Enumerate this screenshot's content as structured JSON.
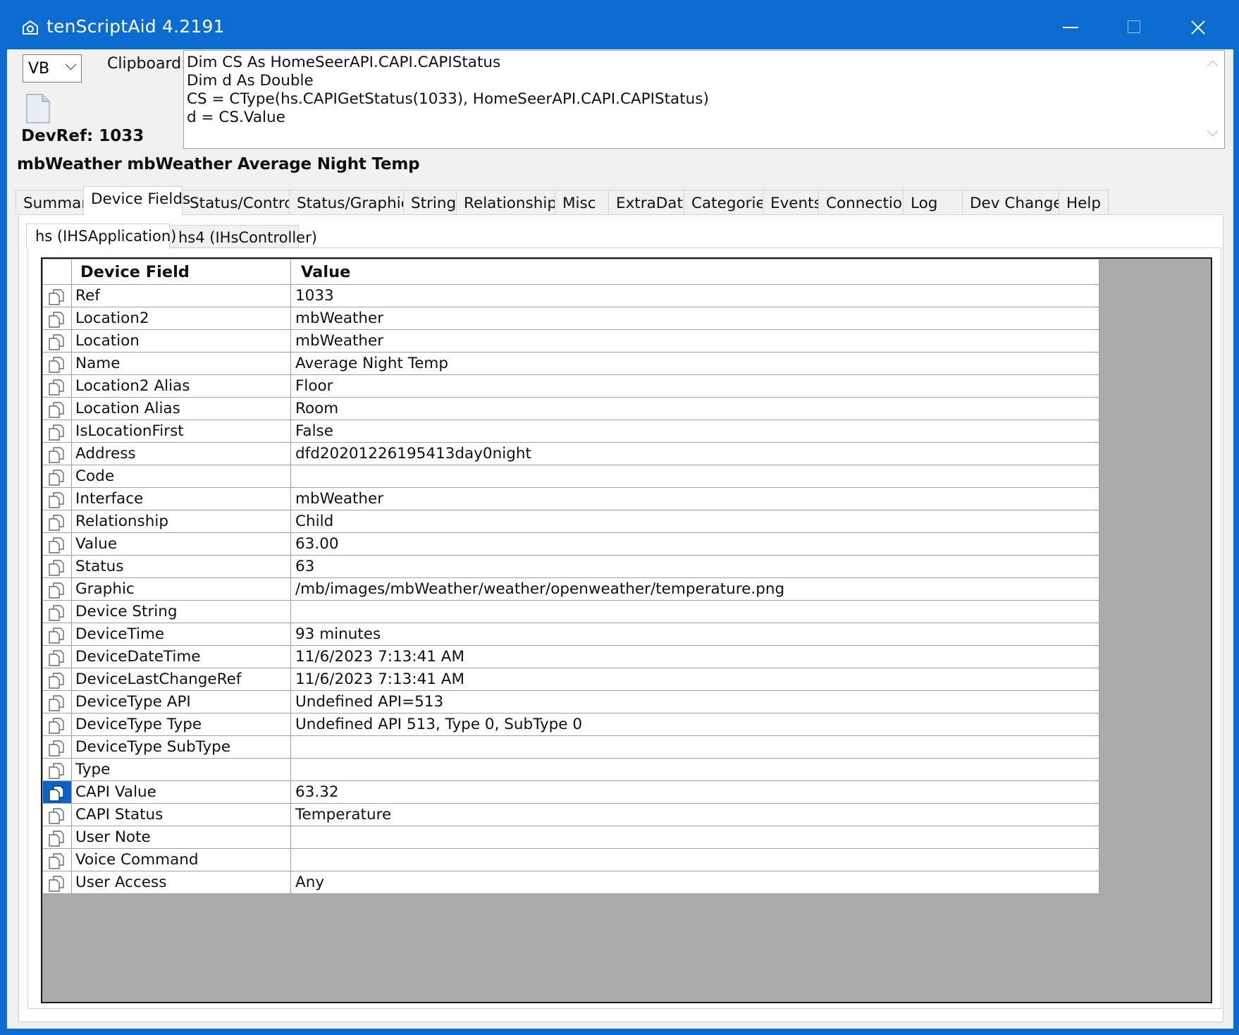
{
  "window": {
    "title": "tenScriptAid 4.2191"
  },
  "toolbar": {
    "language": "VB",
    "clipboard_label": "Clipboard:",
    "clipboard_lines": [
      "Dim CS As HomeSeerAPI.CAPI.CAPIStatus",
      "Dim d As Double",
      "CS = CType(hs.CAPIGetStatus(1033), HomeSeerAPI.CAPI.CAPIStatus)",
      "d = CS.Value"
    ],
    "devref": "DevRef: 1033",
    "device_name": "mbWeather mbWeather Average Night Temp"
  },
  "tabs": [
    "Summary",
    "Device Fields",
    "Status/Controls",
    "Status/Graphics",
    "String",
    "Relationships",
    "Misc",
    "ExtraData",
    "Categories",
    "Events",
    "Connection",
    "Log",
    "Dev Changes",
    "Help"
  ],
  "active_tab": "Device Fields",
  "subtabs": [
    "hs (IHSApplication)",
    "hs4 (IHsController)"
  ],
  "active_subtab": "hs (IHSApplication)",
  "grid": {
    "headers": [
      "Device Field",
      "Value"
    ],
    "rows": [
      {
        "field": "Ref",
        "value": "1033"
      },
      {
        "field": "Location2",
        "value": "mbWeather"
      },
      {
        "field": "Location",
        "value": "mbWeather"
      },
      {
        "field": "Name",
        "value": "Average Night Temp"
      },
      {
        "field": "Location2 Alias",
        "value": "Floor"
      },
      {
        "field": "Location Alias",
        "value": "Room"
      },
      {
        "field": "IsLocationFirst",
        "value": "False"
      },
      {
        "field": "Address",
        "value": "dfd20201226195413day0night"
      },
      {
        "field": "Code",
        "value": ""
      },
      {
        "field": "Interface",
        "value": "mbWeather"
      },
      {
        "field": "Relationship",
        "value": "Child"
      },
      {
        "field": "Value",
        "value": "63.00"
      },
      {
        "field": "Status",
        "value": "63"
      },
      {
        "field": "Graphic",
        "value": "/mb/images/mbWeather/weather/openweather/temperature.png"
      },
      {
        "field": "Device String",
        "value": ""
      },
      {
        "field": "DeviceTime",
        "value": "93 minutes"
      },
      {
        "field": "DeviceDateTime",
        "value": "11/6/2023 7:13:41 AM"
      },
      {
        "field": "DeviceLastChangeRef",
        "value": "11/6/2023 7:13:41 AM"
      },
      {
        "field": "DeviceType API",
        "value": "Undefined API=513"
      },
      {
        "field": "DeviceType Type",
        "value": "Undefined API 513, Type 0, SubType 0"
      },
      {
        "field": "DeviceType SubType",
        "value": ""
      },
      {
        "field": "Type",
        "value": ""
      },
      {
        "field": "CAPI Value",
        "value": "63.32"
      },
      {
        "field": "CAPI Status",
        "value": "Temperature"
      },
      {
        "field": "User Note",
        "value": ""
      },
      {
        "field": "Voice Command",
        "value": ""
      },
      {
        "field": "User Access",
        "value": "Any"
      }
    ],
    "selected_row_index": 22
  },
  "colors": {
    "titlebar": "#0a6cd1",
    "selection": "#0a64c8",
    "grid_background": "#ababab"
  },
  "icons": {
    "app": "app-icon",
    "copy": "copy-icon"
  }
}
